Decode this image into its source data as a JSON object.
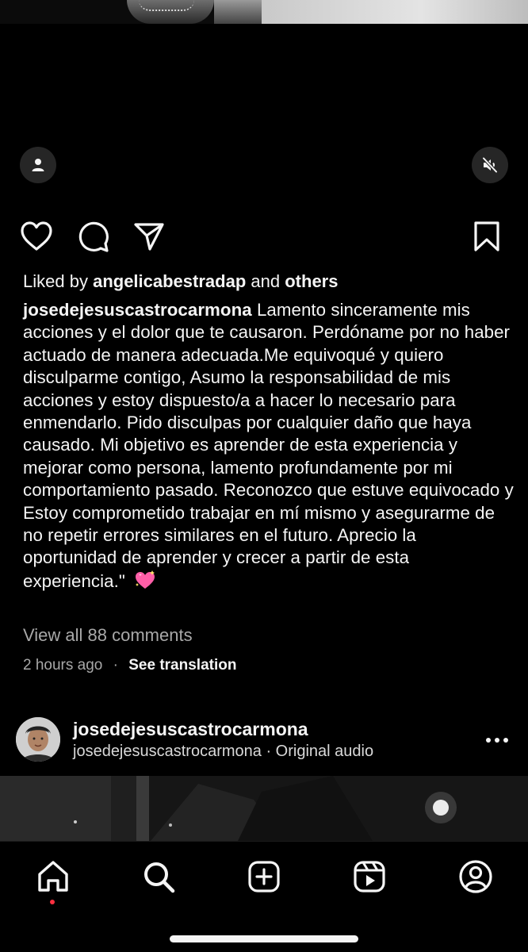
{
  "post": {
    "liked_by_prefix": "Liked by",
    "liked_by_user": "angelicabestradap",
    "liked_by_and": "and",
    "liked_by_others": "others",
    "caption_username": "josedejesuscastrocarmona",
    "caption_text": "Lamento sinceramente mis acciones y el dolor que te causaron. Perdóname por no haber actuado de manera adecuada.Me equivoqué y quiero disculparme contigo, Asumo la responsabilidad de mis acciones y estoy dispuesto/a a hacer lo necesario para enmendarlo. Pido disculpas por cualquier daño que haya causado. Mi objetivo es aprender de esta experiencia y mejorar como persona, lamento profundamente por mi comportamiento pasado. Reconozco que estuve equivocado y Estoy comprometido  trabajar en mí mismo  y asegurarme de no repetir errores similares en el futuro. Aprecio la oportunidad de aprender y crecer a partir de esta experiencia.\"",
    "caption_emoji": "sparkling-heart",
    "view_comments": "View all 88 comments",
    "timestamp": "2 hours ago",
    "separator": "·",
    "see_translation": "See translation"
  },
  "next_post": {
    "username": "josedejesuscastrocarmona",
    "audio": "josedejesuscastrocarmona · Original audio"
  },
  "icons": {
    "user_tag": "person-icon",
    "mute": "speaker-muted-icon",
    "like": "heart-icon",
    "comment": "comment-icon",
    "share": "paper-plane-icon",
    "save": "bookmark-icon",
    "more": "more-dots-icon",
    "tabs": [
      "home-icon",
      "search-icon",
      "create-icon",
      "reels-icon",
      "profile-icon"
    ]
  },
  "colors": {
    "background": "#000000",
    "text": "#f5f5f5",
    "muted": "#a8a8a8",
    "notification_dot": "#ff3040",
    "emoji_pink": "#ff5fa8"
  }
}
